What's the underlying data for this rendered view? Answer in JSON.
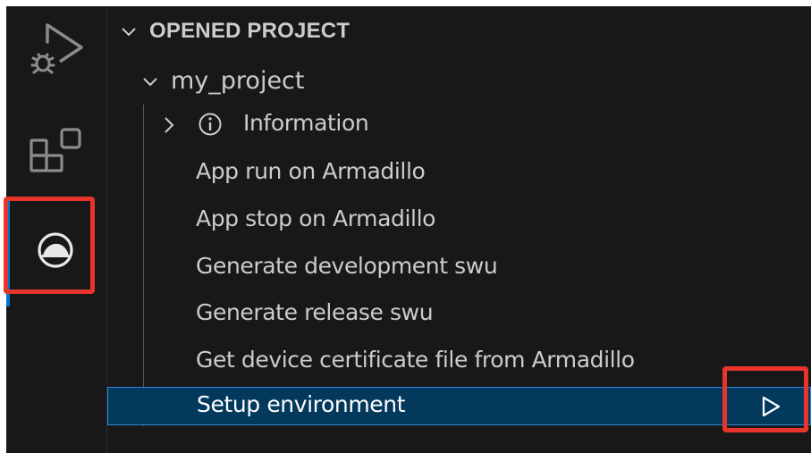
{
  "colors": {
    "background": "#181818",
    "text": "#cccccc",
    "selection_bg": "#04395e",
    "selection_border": "#2b88d8",
    "highlight_box": "#e8352b",
    "active_indicator": "#0078d4"
  },
  "activity_bar": {
    "items": [
      {
        "name": "run-and-debug",
        "icon": "run-debug-icon"
      },
      {
        "name": "extensions",
        "icon": "extensions-icon"
      },
      {
        "name": "armadillo",
        "icon": "armadillo-icon",
        "active": true
      }
    ]
  },
  "sidebar": {
    "section_title": "OPENED PROJECT",
    "project_name": "my_project",
    "items": [
      {
        "label": "Information",
        "icon": "info-icon",
        "expandable": true
      },
      {
        "label": "App run on Armadillo"
      },
      {
        "label": "App stop on Armadillo"
      },
      {
        "label": "Generate development swu"
      },
      {
        "label": "Generate release swu"
      },
      {
        "label": "Get device certificate file from Armadillo"
      },
      {
        "label": "Setup environment",
        "selected": true,
        "action_icon": "play-icon"
      }
    ]
  }
}
